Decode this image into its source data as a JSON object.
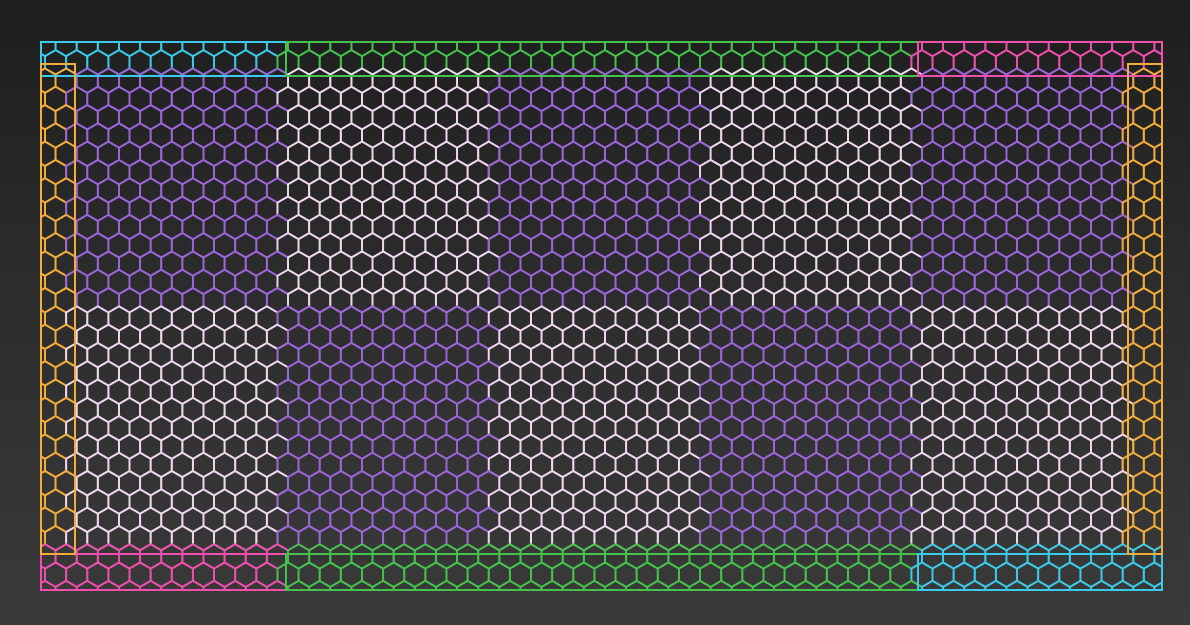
{
  "pattern": {
    "shape": "hexagon-grid",
    "cell_size": "small",
    "zones": {
      "corner_top_left": "cyan",
      "corner_bottom_right": "cyan",
      "corner_top_right": "magenta",
      "corner_bottom_left": "magenta",
      "edge_top_bottom": "green",
      "edge_left_right": "amber",
      "checker_dark": "violet",
      "checker_light": "pale-pink"
    }
  },
  "colors": {
    "background_top": "#1e1e1e",
    "background_bottom": "#3a3a3a",
    "cyan": "#3ccaea",
    "magenta": "#f04fae",
    "green": "#44c24c",
    "amber": "#f3ad3a",
    "violet": "#9b66d8",
    "pale_pink": "#efd8ee"
  }
}
